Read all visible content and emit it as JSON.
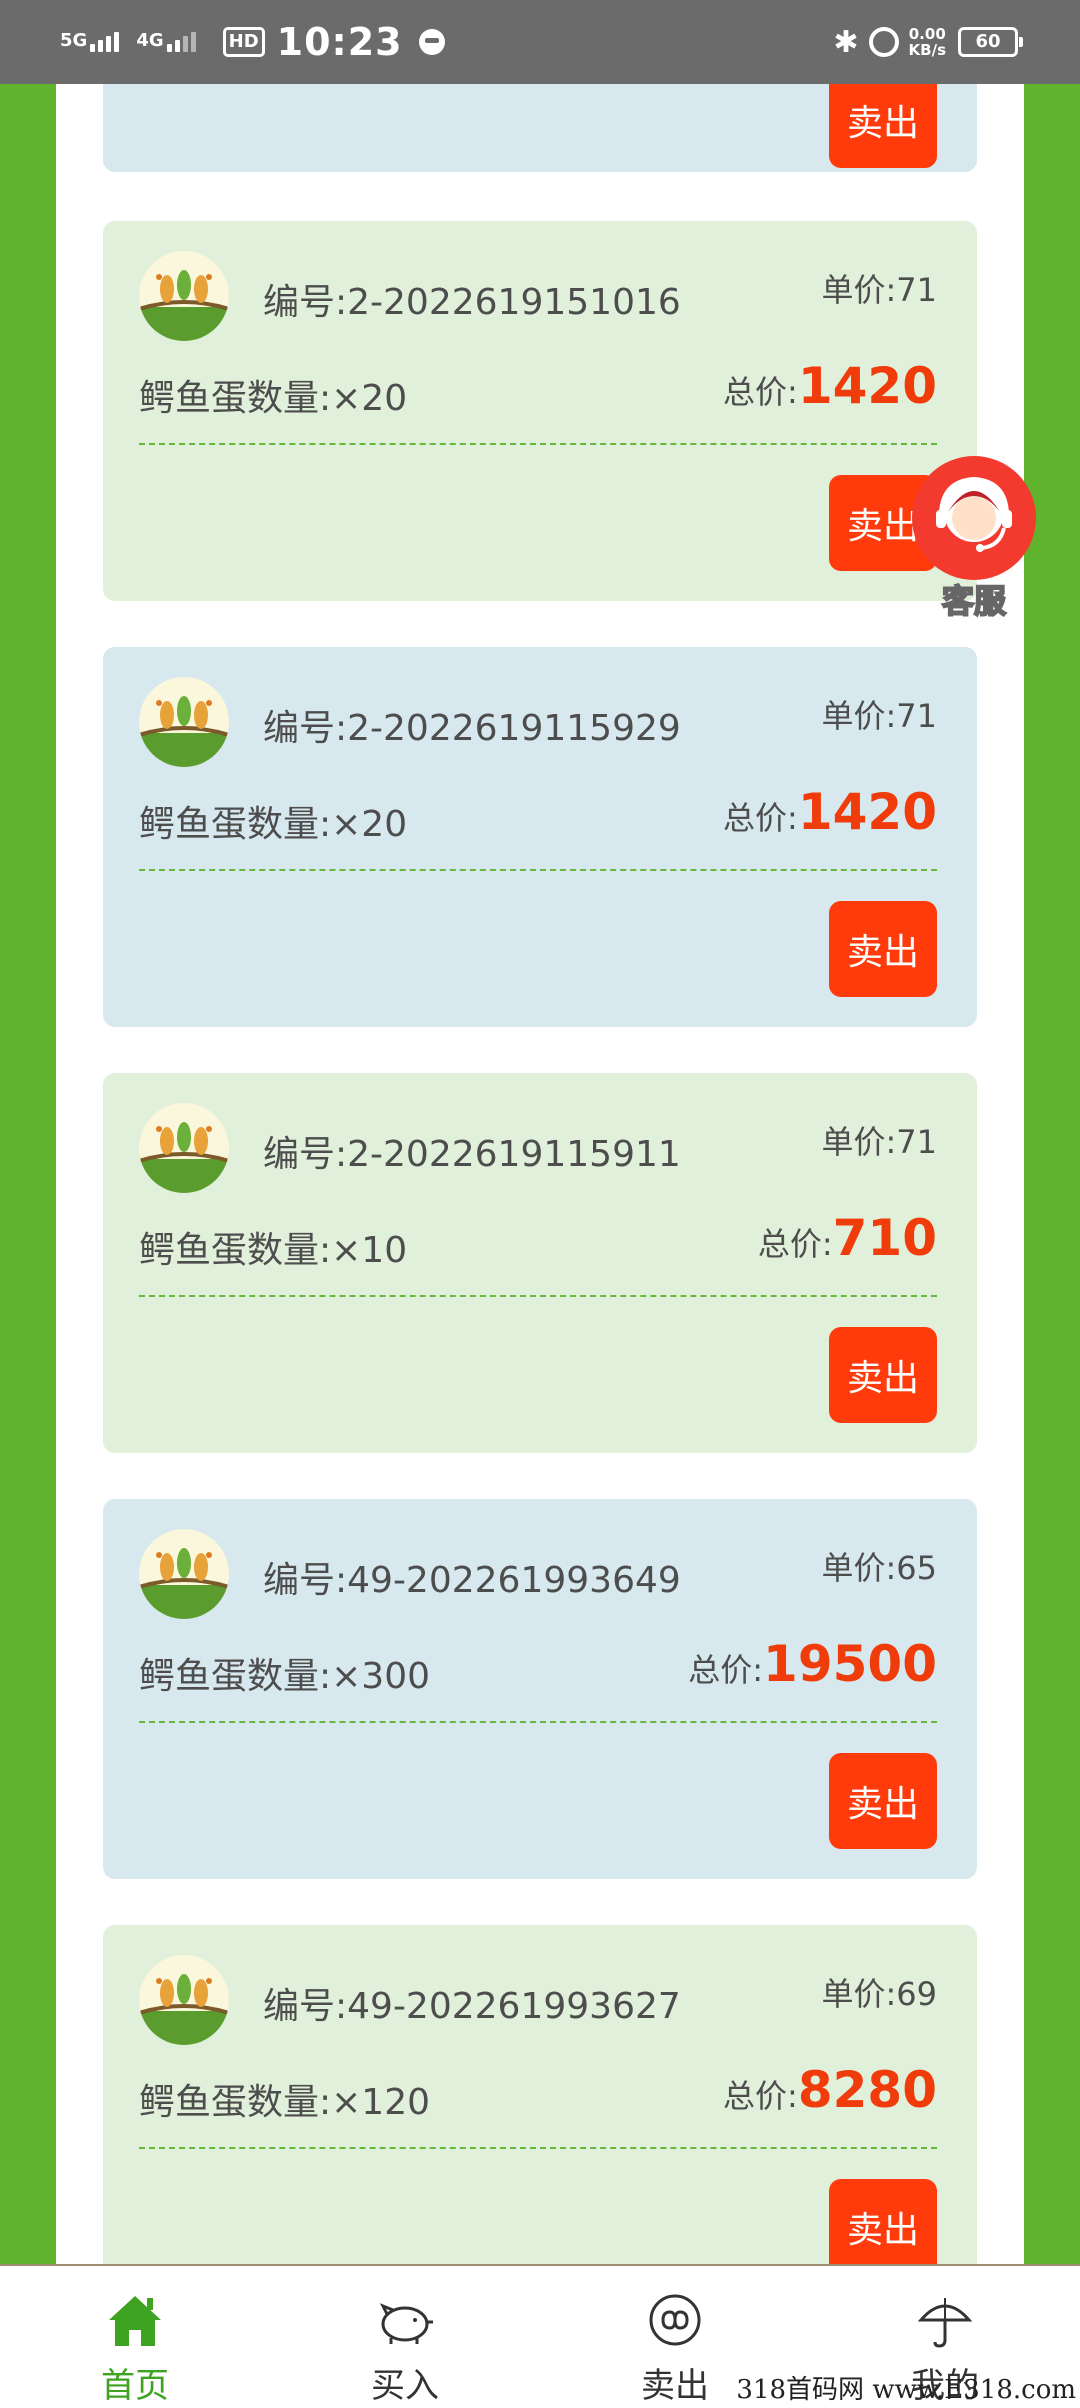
{
  "status_bar": {
    "signal1": "5G",
    "signal2": "4G",
    "hd": "HD",
    "time": "10:23",
    "net_speed": "0.00",
    "net_unit": "KB/s",
    "battery": "60"
  },
  "cards": [
    {
      "sell_label": "卖出",
      "theme": "blue"
    },
    {
      "order_no": "编号:2-2022619151016",
      "unit_price": "单价:71",
      "quantity": "鳄鱼蛋数量:×20",
      "total_label": "总价:",
      "total_value": "1420",
      "sell_label": "卖出",
      "theme": "green"
    },
    {
      "order_no": "编号:2-2022619115929",
      "unit_price": "单价:71",
      "quantity": "鳄鱼蛋数量:×20",
      "total_label": "总价:",
      "total_value": "1420",
      "sell_label": "卖出",
      "theme": "blue"
    },
    {
      "order_no": "编号:2-2022619115911",
      "unit_price": "单价:71",
      "quantity": "鳄鱼蛋数量:×10",
      "total_label": "总价:",
      "total_value": "710",
      "sell_label": "卖出",
      "theme": "green"
    },
    {
      "order_no": "编号:49-202261993649",
      "unit_price": "单价:65",
      "quantity": "鳄鱼蛋数量:×300",
      "total_label": "总价:",
      "total_value": "19500",
      "sell_label": "卖出",
      "theme": "blue"
    },
    {
      "order_no": "编号:49-202261993627",
      "unit_price": "单价:69",
      "quantity": "鳄鱼蛋数量:×120",
      "total_label": "总价:",
      "total_value": "8280",
      "sell_label": "卖出",
      "theme": "green"
    }
  ],
  "customer_service": {
    "label": "客服"
  },
  "bottom_nav": [
    {
      "label": "首页",
      "icon": "home-icon",
      "active": true
    },
    {
      "label": "买入",
      "icon": "piggy-bank-icon",
      "active": false
    },
    {
      "label": "卖出",
      "icon": "sell-icon",
      "active": false
    },
    {
      "label": "我的",
      "icon": "umbrella-icon",
      "active": false
    }
  ],
  "watermark": "318首码网 www.E318.com",
  "colors": {
    "side_green": "#5fb32d",
    "card_green": "#e1f0da",
    "card_blue": "#d7e9ee",
    "sell_button": "#ff3b0c",
    "price_red": "#f03c0a",
    "active_nav": "#3ea320"
  }
}
